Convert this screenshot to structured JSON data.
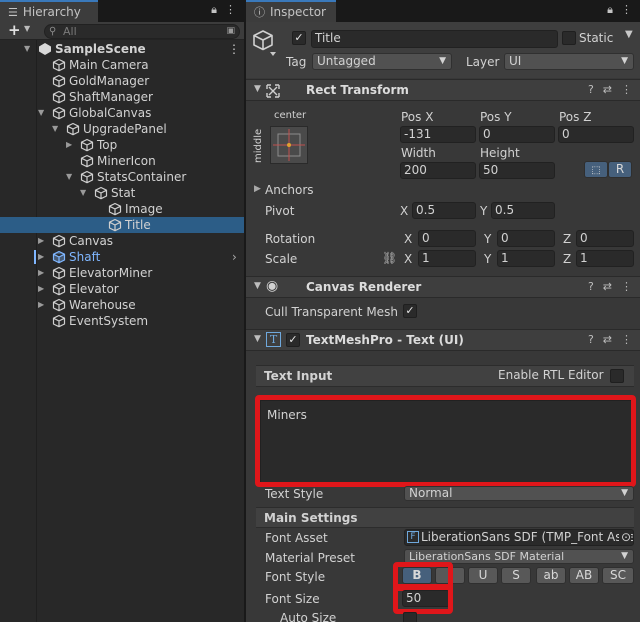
{
  "hierarchy": {
    "tab_label": "Hierarchy",
    "add_label": "+",
    "search_placeholder": "All",
    "rows": [
      {
        "label": "SampleScene",
        "depth": 0,
        "fold": "open",
        "icon": "unity-scene-icon",
        "bold": true
      },
      {
        "label": "Main Camera",
        "depth": 1,
        "fold": "none",
        "icon": "cube-icon"
      },
      {
        "label": "GoldManager",
        "depth": 1,
        "fold": "none",
        "icon": "cube-icon"
      },
      {
        "label": "ShaftManager",
        "depth": 1,
        "fold": "none",
        "icon": "cube-icon"
      },
      {
        "label": "GlobalCanvas",
        "depth": 1,
        "fold": "open",
        "icon": "cube-icon"
      },
      {
        "label": "UpgradePanel",
        "depth": 2,
        "fold": "open",
        "icon": "cube-icon"
      },
      {
        "label": "Top",
        "depth": 3,
        "fold": "closed",
        "icon": "cube-icon"
      },
      {
        "label": "MinerIcon",
        "depth": 3,
        "fold": "none",
        "icon": "cube-icon"
      },
      {
        "label": "StatsContainer",
        "depth": 3,
        "fold": "open",
        "icon": "cube-icon"
      },
      {
        "label": "Stat",
        "depth": 4,
        "fold": "open",
        "icon": "cube-icon"
      },
      {
        "label": "Image",
        "depth": 5,
        "fold": "none",
        "icon": "cube-icon"
      },
      {
        "label": "Title",
        "depth": 5,
        "fold": "none",
        "icon": "cube-icon",
        "selected": true
      },
      {
        "label": "Canvas",
        "depth": 1,
        "fold": "closed",
        "icon": "cube-icon"
      },
      {
        "label": "Shaft",
        "depth": 1,
        "fold": "closed",
        "icon": "prefab-cube-icon",
        "prefab": true
      },
      {
        "label": "ElevatorMiner",
        "depth": 1,
        "fold": "closed",
        "icon": "cube-icon"
      },
      {
        "label": "Elevator",
        "depth": 1,
        "fold": "closed",
        "icon": "cube-icon"
      },
      {
        "label": "Warehouse",
        "depth": 1,
        "fold": "closed",
        "icon": "cube-icon"
      },
      {
        "label": "EventSystem",
        "depth": 1,
        "fold": "none",
        "icon": "cube-icon"
      }
    ]
  },
  "inspector": {
    "tab_label": "Inspector",
    "object_name": "Title",
    "static_label": "Static",
    "tag_label": "Tag",
    "tag_value": "Untagged",
    "layer_label": "Layer",
    "layer_value": "UI",
    "rect_transform": {
      "title": "Rect Transform",
      "anchor_h": "center",
      "anchor_v": "middle",
      "pos_x_label": "Pos X",
      "pos_x": "-131",
      "pos_y_label": "Pos Y",
      "pos_y": "0",
      "pos_z_label": "Pos Z",
      "pos_z": "0",
      "width_label": "Width",
      "width": "200",
      "height_label": "Height",
      "height": "50",
      "r_button": "R",
      "anchors_label": "Anchors",
      "pivot_label": "Pivot",
      "pivot_x": "0.5",
      "pivot_y": "0.5",
      "rotation_label": "Rotation",
      "rot_x": "0",
      "rot_y": "0",
      "rot_z": "0",
      "scale_label": "Scale",
      "scale_x": "1",
      "scale_y": "1",
      "scale_z": "1",
      "x": "X",
      "y": "Y",
      "z": "Z"
    },
    "canvas_renderer": {
      "title": "Canvas Renderer",
      "cull_label": "Cull Transparent Mesh"
    },
    "tmp": {
      "title": "TextMeshPro - Text (UI)",
      "text_input_label": "Text Input",
      "rtl_label": "Enable RTL Editor",
      "text_value": "Miners",
      "text_style_label": "Text Style",
      "text_style_value": "Normal",
      "main_settings_label": "Main Settings",
      "font_asset_label": "Font Asset",
      "font_asset_value": "LiberationSans SDF (TMP_Font Asse",
      "material_preset_label": "Material Preset",
      "material_preset_value": "LiberationSans SDF Material",
      "font_style_label": "Font Style",
      "style_buttons": [
        "B",
        "I",
        "U",
        "S",
        "ab",
        "AB",
        "SC"
      ],
      "font_size_label": "Font Size",
      "font_size_value": "50",
      "auto_size_label": "Auto Size"
    }
  },
  "colors": {
    "selection": "#2c5d87",
    "highlight_red": "#e0161a",
    "prefab_blue": "#7fb6ff"
  }
}
